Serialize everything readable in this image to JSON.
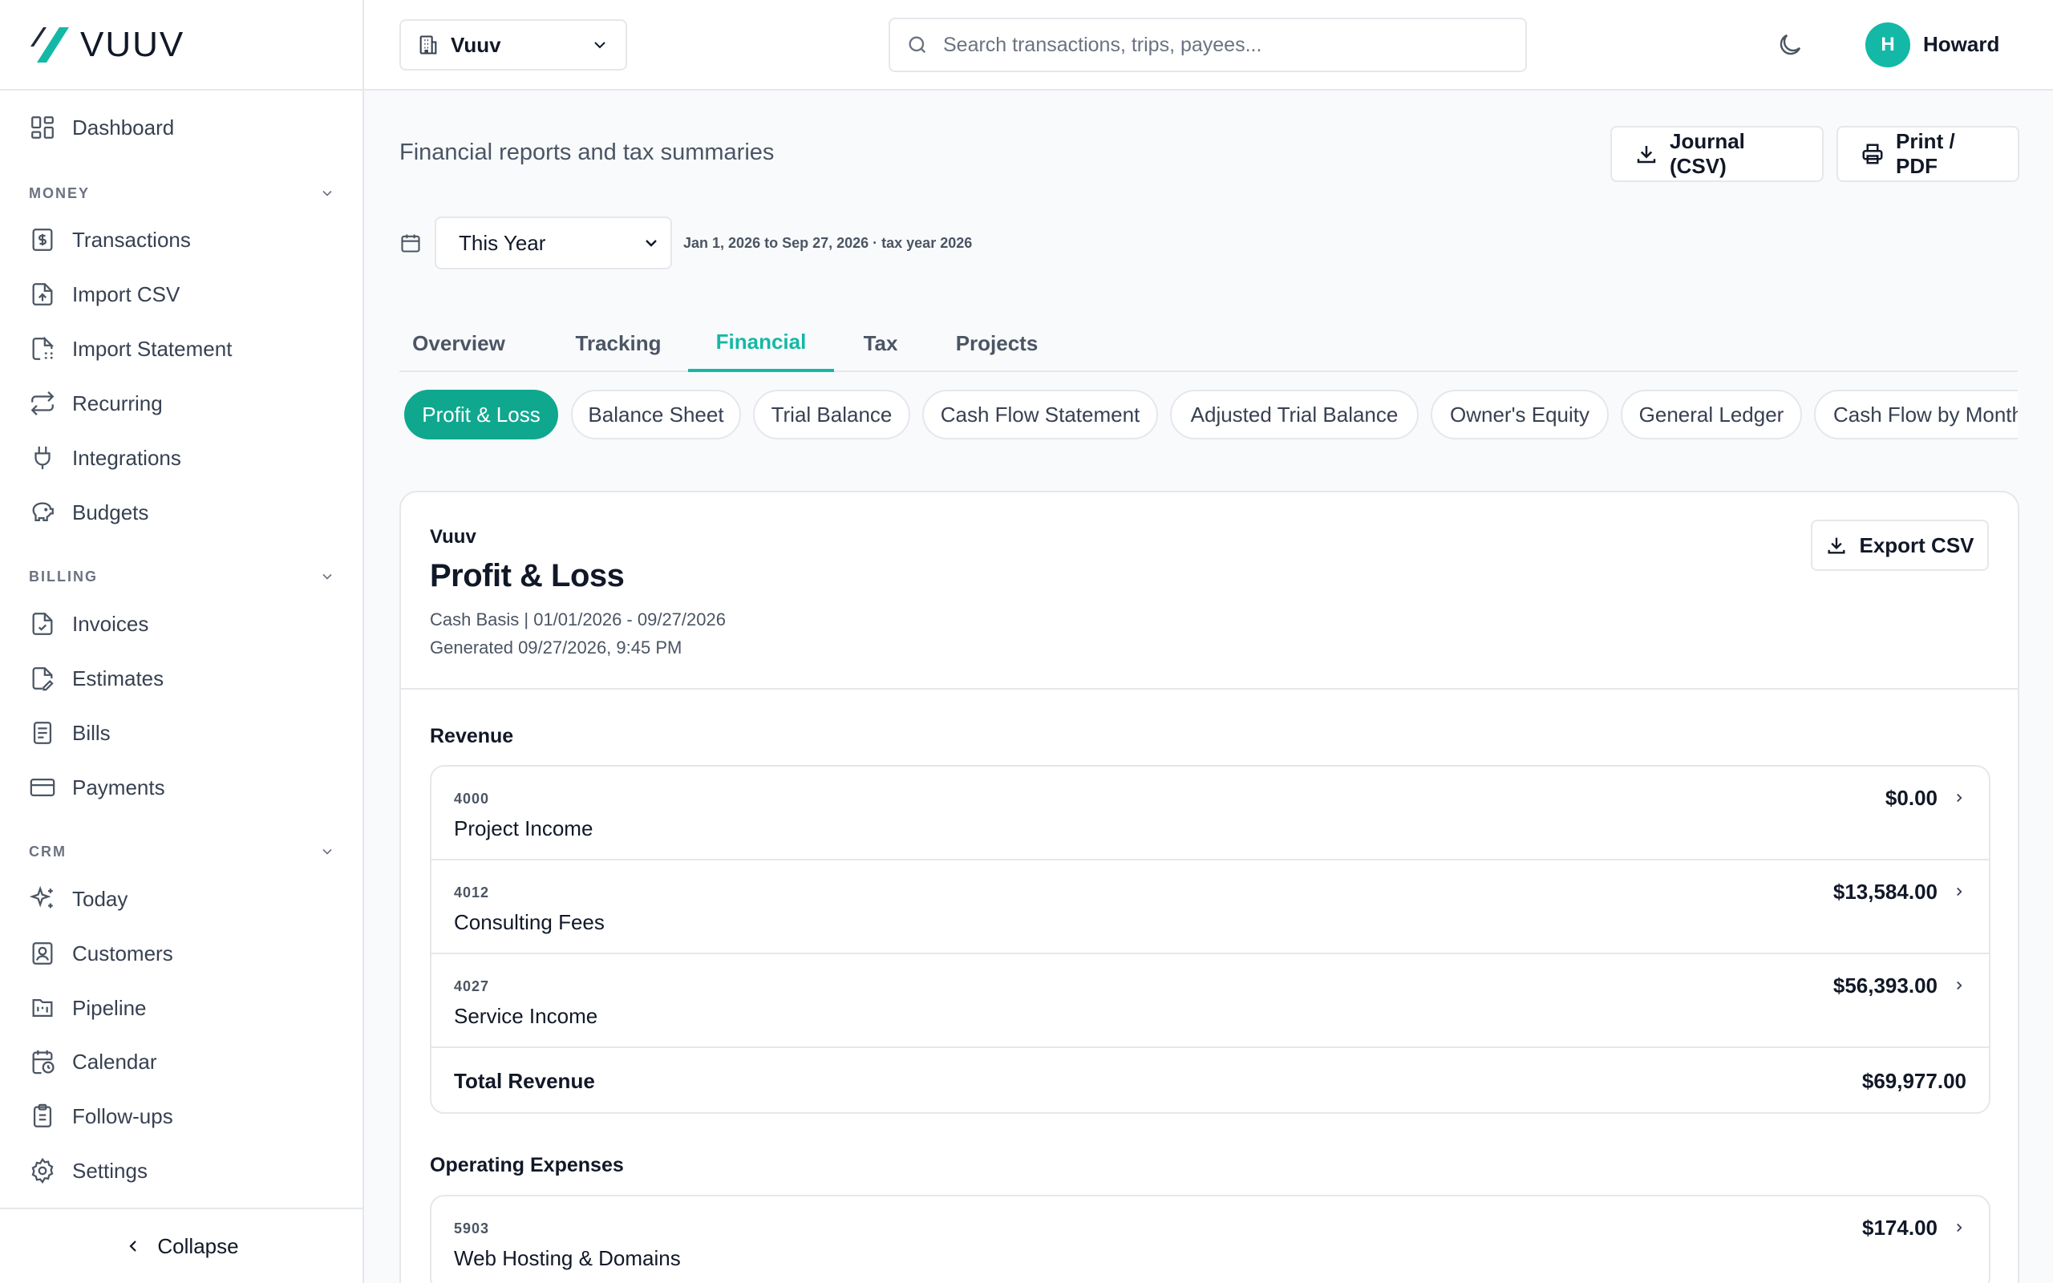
{
  "brand": {
    "name": "VUUV"
  },
  "sidebar": {
    "top": [
      {
        "label": "Dashboard",
        "icon": "dashboard-grid-icon"
      }
    ],
    "sections": [
      {
        "label": "MONEY",
        "items": [
          {
            "label": "Transactions",
            "icon": "dollar-doc-icon"
          },
          {
            "label": "Import CSV",
            "icon": "file-upload-icon"
          },
          {
            "label": "Import Statement",
            "icon": "file-scan-icon"
          },
          {
            "label": "Recurring",
            "icon": "repeat-icon"
          },
          {
            "label": "Integrations",
            "icon": "plug-icon"
          },
          {
            "label": "Budgets",
            "icon": "piggy-bank-icon"
          }
        ]
      },
      {
        "label": "BILLING",
        "items": [
          {
            "label": "Invoices",
            "icon": "file-check-icon"
          },
          {
            "label": "Estimates",
            "icon": "file-pen-icon"
          },
          {
            "label": "Bills",
            "icon": "receipt-icon"
          },
          {
            "label": "Payments",
            "icon": "credit-card-icon"
          }
        ]
      },
      {
        "label": "CRM",
        "items": [
          {
            "label": "Today",
            "icon": "sparkles-icon"
          },
          {
            "label": "Customers",
            "icon": "contact-icon"
          },
          {
            "label": "Pipeline",
            "icon": "kanban-icon"
          },
          {
            "label": "Calendar",
            "icon": "calendar-clock-icon"
          },
          {
            "label": "Follow-ups",
            "icon": "clipboard-list-icon"
          }
        ]
      }
    ],
    "bottom": [
      {
        "label": "Settings",
        "icon": "gear-icon"
      }
    ],
    "collapse_label": "Collapse"
  },
  "topbar": {
    "org": "Vuuv",
    "search_placeholder": "Search transactions, trips, payees...",
    "user_initial": "H",
    "user_name": "Howard"
  },
  "page": {
    "subtitle": "Financial reports and tax summaries",
    "journal_button": "Journal (CSV)",
    "print_button": "Print / PDF",
    "period": "This Year",
    "date_range": "Jan 1, 2026 to Sep 27, 2026 · tax year 2026",
    "tabs": [
      "Overview",
      "Tracking",
      "Financial",
      "Tax",
      "Projects"
    ],
    "active_tab": "Financial",
    "report_types": [
      "Profit & Loss",
      "Balance Sheet",
      "Trial Balance",
      "Cash Flow Statement",
      "Adjusted Trial Balance",
      "Owner's Equity",
      "General Ledger",
      "Cash Flow by Month"
    ],
    "active_report": "Profit & Loss"
  },
  "report": {
    "org": "Vuuv",
    "title": "Profit & Loss",
    "basis": "Cash Basis | 01/01/2026 - 09/27/2026",
    "generated": "Generated 09/27/2026, 9:45 PM",
    "export_label": "Export CSV",
    "revenue": {
      "title": "Revenue",
      "accounts": [
        {
          "code": "4000",
          "name": "Project Income",
          "amount": "$0.00"
        },
        {
          "code": "4012",
          "name": "Consulting Fees",
          "amount": "$13,584.00"
        },
        {
          "code": "4027",
          "name": "Service Income",
          "amount": "$56,393.00"
        }
      ],
      "total_label": "Total Revenue",
      "total": "$69,977.00"
    },
    "expenses": {
      "title": "Operating Expenses",
      "accounts": [
        {
          "code": "5903",
          "name": "Web Hosting & Domains",
          "amount": "$174.00"
        }
      ]
    }
  }
}
